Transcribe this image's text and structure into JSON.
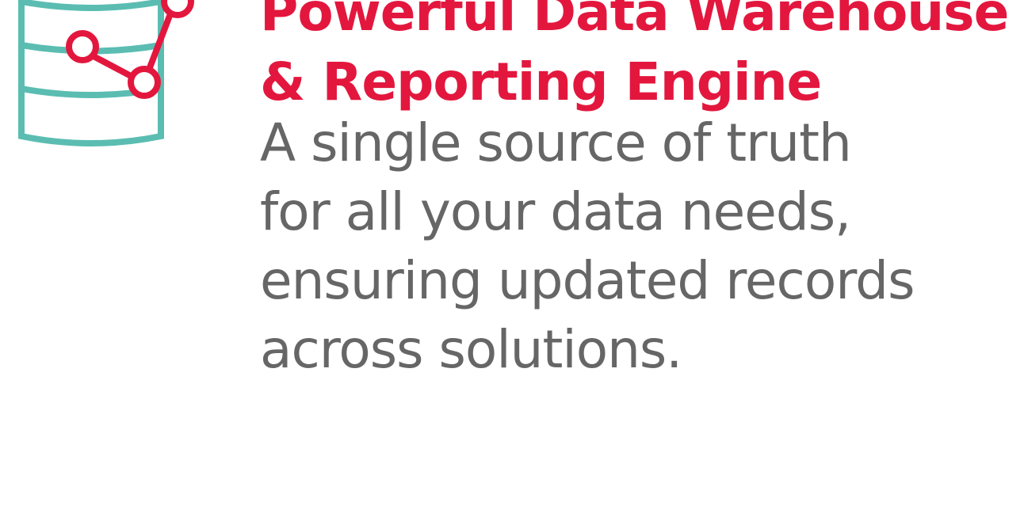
{
  "colors": {
    "accent": "#e3173e",
    "body_text": "#666666",
    "icon_teal": "#5bbdb2",
    "background": "#ffffff"
  },
  "icon": {
    "name": "database-chart-icon"
  },
  "headline": {
    "line1": "Powerful Data Warehouse",
    "line2": "& Reporting Engine"
  },
  "description": {
    "line1": "A single source of truth",
    "line2": "for all your data needs,",
    "line3": "ensuring updated records",
    "line4": "across solutions."
  }
}
